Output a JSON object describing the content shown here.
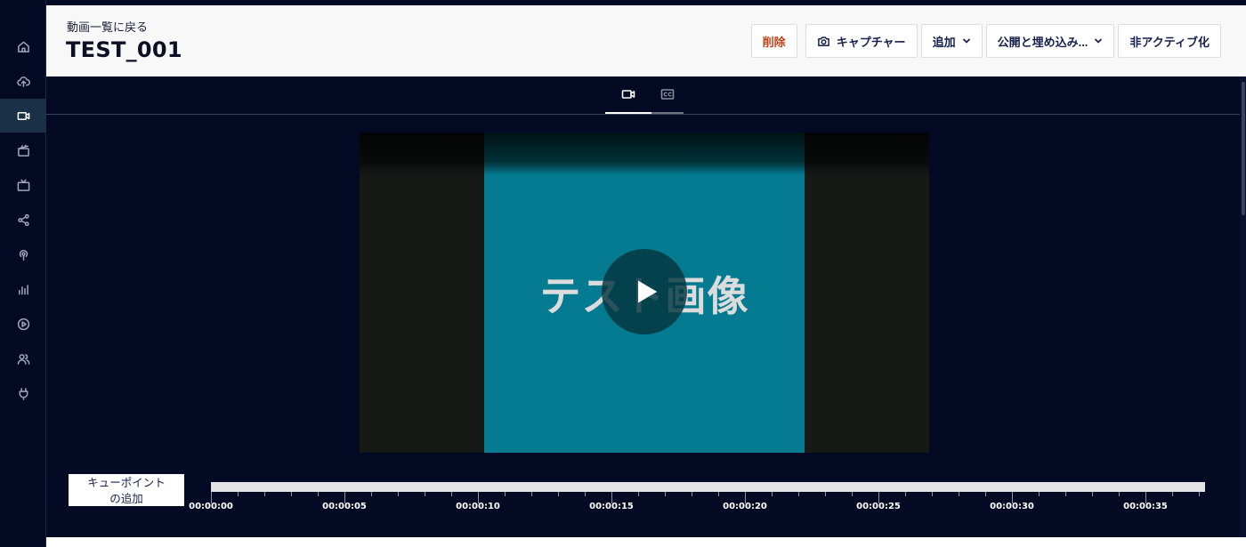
{
  "header": {
    "back_link": "動画一覧に戻る",
    "title": "TEST_001"
  },
  "actions": {
    "delete": "削除",
    "capture": "キャプチャー",
    "add": "追加",
    "publish_embed": "公開と埋め込み...",
    "deactivate": "非アクティブ化"
  },
  "sidebar": {
    "items": [
      {
        "icon": "home-icon"
      },
      {
        "icon": "upload-icon"
      },
      {
        "icon": "video-icon",
        "active": true
      },
      {
        "icon": "clapperboard-icon"
      },
      {
        "icon": "tv-icon"
      },
      {
        "icon": "share-icon"
      },
      {
        "icon": "broadcast-icon"
      },
      {
        "icon": "analytics-icon"
      },
      {
        "icon": "play-circle-icon"
      },
      {
        "icon": "users-icon"
      },
      {
        "icon": "plug-icon"
      }
    ]
  },
  "tabs": [
    {
      "icon": "video-icon",
      "active": true
    },
    {
      "icon": "closed-captions-icon",
      "active": false
    }
  ],
  "player": {
    "overlay_text": "テスト画像"
  },
  "timeline": {
    "cue_button": "キューポイント\nの追加",
    "labels": [
      "00:00:00",
      "00:00:05",
      "00:00:10",
      "00:00:15",
      "00:00:20",
      "00:00:25",
      "00:00:30",
      "00:00:35"
    ]
  },
  "colors": {
    "background": "#050a24",
    "header": "#f8f8f8",
    "accent_active": "#1a3047",
    "danger": "#c0431a",
    "video_frame": "#047b91"
  }
}
